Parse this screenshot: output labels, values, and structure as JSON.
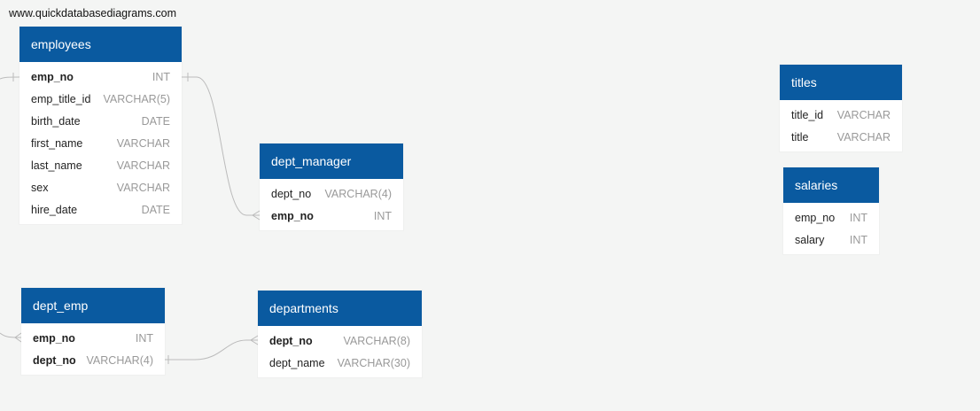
{
  "site": {
    "label": "www.quickdatabasediagrams.com"
  },
  "tables": {
    "employees": {
      "title": "employees",
      "columns": [
        {
          "name": "emp_no",
          "type": "INT",
          "pk": true
        },
        {
          "name": "emp_title_id",
          "type": "VARCHAR(5)",
          "pk": false
        },
        {
          "name": "birth_date",
          "type": "DATE",
          "pk": false
        },
        {
          "name": "first_name",
          "type": "VARCHAR",
          "pk": false
        },
        {
          "name": "last_name",
          "type": "VARCHAR",
          "pk": false
        },
        {
          "name": "sex",
          "type": "VARCHAR",
          "pk": false
        },
        {
          "name": "hire_date",
          "type": "DATE",
          "pk": false
        }
      ]
    },
    "dept_manager": {
      "title": "dept_manager",
      "columns": [
        {
          "name": "dept_no",
          "type": "VARCHAR(4)",
          "pk": false
        },
        {
          "name": "emp_no",
          "type": "INT",
          "pk": true
        }
      ]
    },
    "dept_emp": {
      "title": "dept_emp",
      "columns": [
        {
          "name": "emp_no",
          "type": "INT",
          "pk": true
        },
        {
          "name": "dept_no",
          "type": "VARCHAR(4)",
          "pk": true
        }
      ]
    },
    "departments": {
      "title": "departments",
      "columns": [
        {
          "name": "dept_no",
          "type": "VARCHAR(8)",
          "pk": true
        },
        {
          "name": "dept_name",
          "type": "VARCHAR(30)",
          "pk": false
        }
      ]
    },
    "titles": {
      "title": "titles",
      "columns": [
        {
          "name": "title_id",
          "type": "VARCHAR",
          "pk": false
        },
        {
          "name": "title",
          "type": "VARCHAR",
          "pk": false
        }
      ]
    },
    "salaries": {
      "title": "salaries",
      "columns": [
        {
          "name": "emp_no",
          "type": "INT",
          "pk": false
        },
        {
          "name": "salary",
          "type": "INT",
          "pk": false
        }
      ]
    }
  },
  "colors": {
    "header": "#0a5aa0",
    "background": "#f4f5f4",
    "connector": "#bbbbbb"
  }
}
